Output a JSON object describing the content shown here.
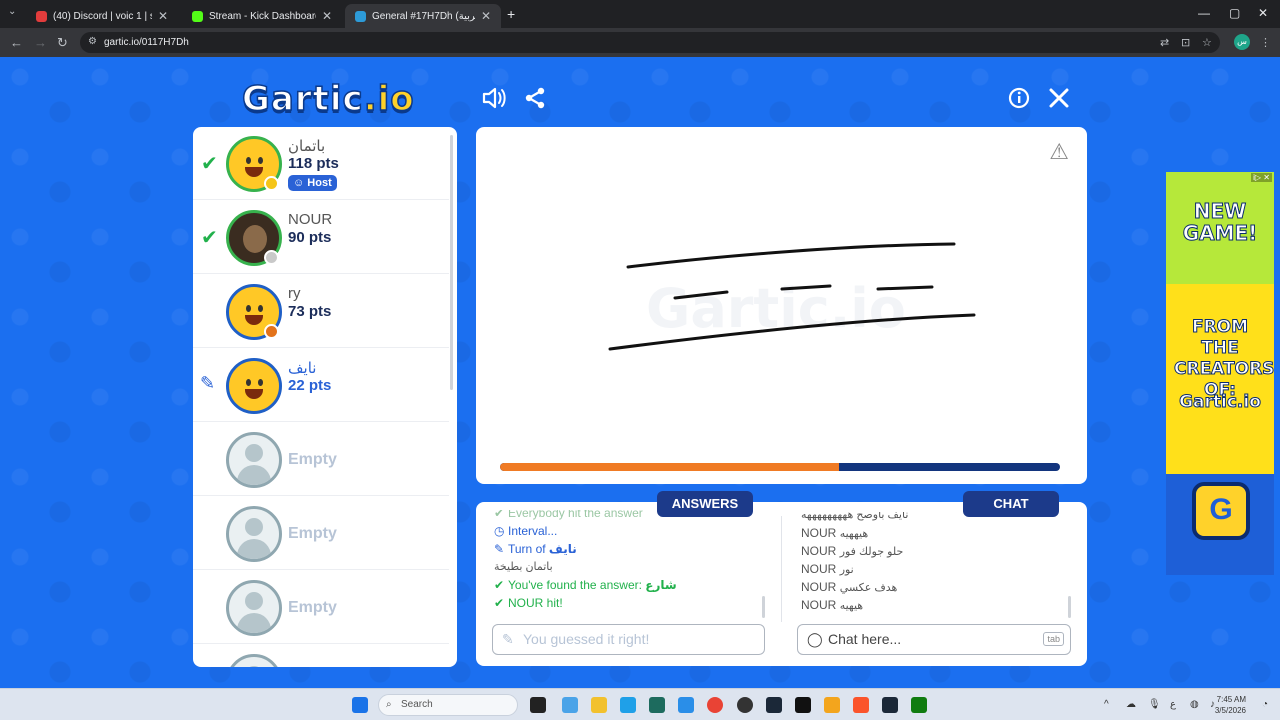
{
  "browser": {
    "tabs": [
      {
        "title": "(40) Discord | voic 1 | shad...",
        "favicon_color": "#e23c3c",
        "active": false
      },
      {
        "title": "Stream - Kick Dashboard",
        "favicon_color": "#53fc18",
        "active": false
      },
      {
        "title": "General #17H7Dh (العربية)",
        "favicon_color": "#2d9bd8",
        "active": true
      }
    ],
    "new_tab": "+",
    "url": "gartic.io/0117H7Dh",
    "window_controls": [
      "—",
      "▢",
      "✕"
    ],
    "profile_initial": "س"
  },
  "game": {
    "logo_main": "Gartic",
    "logo_io": ".io"
  },
  "players": [
    {
      "name": "باتمان",
      "pts": "118 pts",
      "guessed": true,
      "drawing": false,
      "host": true,
      "host_label": "Host",
      "avatar": "yellow",
      "status_color": "#f5c518"
    },
    {
      "name": "NOUR",
      "pts": "90 pts",
      "guessed": true,
      "drawing": false,
      "host": false,
      "avatar": "photo",
      "status_color": "#c9c9c9"
    },
    {
      "name": "ry",
      "pts": "73 pts",
      "guessed": false,
      "drawing": false,
      "host": false,
      "avatar": "yellow",
      "status_color": "#e3731b"
    },
    {
      "name": "نايف",
      "pts": "22 pts",
      "guessed": false,
      "drawing": true,
      "host": false,
      "avatar": "yellow"
    },
    {
      "name": "Empty"
    },
    {
      "name": "Empty"
    },
    {
      "name": "Empty"
    }
  ],
  "canvas": {
    "watermark": "Gartic.io",
    "progress": 0.605
  },
  "answers": {
    "title": "ANSWERS",
    "lines": [
      {
        "text": "Everybody hit the answer",
        "icon": "✔",
        "style": "faded"
      },
      {
        "text": "Interval...",
        "icon": "◷",
        "style": "blue"
      },
      {
        "text": "Turn of ",
        "highlight": "نايف",
        "icon": "✎",
        "style": "blue"
      },
      {
        "text": "باتمان بطيخة",
        "icon": "",
        "style": "grey"
      },
      {
        "text": "You've found the answer: ",
        "highlight": "شارع",
        "icon": "✔",
        "style": "green"
      },
      {
        "text": "NOUR hit!",
        "icon": "✔",
        "style": "green"
      }
    ],
    "input_placeholder": "You guessed it right!"
  },
  "chat": {
    "title": "CHAT",
    "lines": [
      {
        "user": "",
        "message": "نايف باوصح هههههههههه"
      },
      {
        "user": "NOUR",
        "message": "هيههيه"
      },
      {
        "user": "NOUR",
        "message": "حلو جولك فور"
      },
      {
        "user": "NOUR",
        "message": "نور"
      },
      {
        "user": "NOUR",
        "message": "هدف عكسي"
      },
      {
        "user": "NOUR",
        "message": "هيهيه"
      }
    ],
    "input_placeholder": "Chat here...",
    "tab_key": "tab"
  },
  "ad": {
    "headline": "NEW GAME!",
    "subline": "FROM THE CREATORS OF:",
    "brand": "Gartic.io",
    "badge": "i▷ ✕"
  },
  "taskbar": {
    "search_label": "Search",
    "time": "7:45 AM",
    "date": "3/5/2026"
  }
}
